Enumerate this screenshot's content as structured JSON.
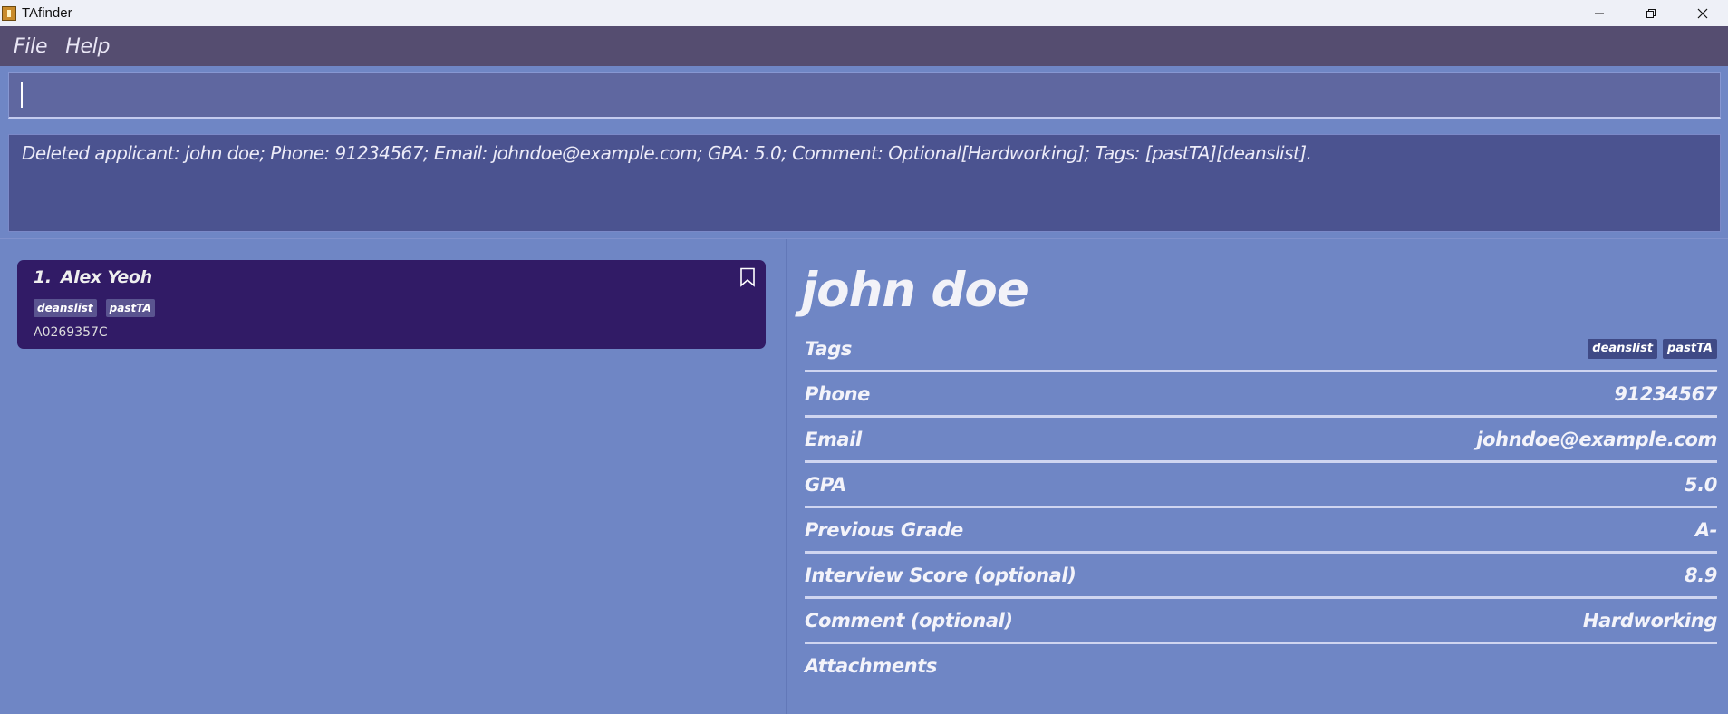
{
  "window": {
    "title": "TAfinder"
  },
  "menu": {
    "items": [
      {
        "label": "File"
      },
      {
        "label": "Help"
      }
    ]
  },
  "command": {
    "value": ""
  },
  "result": {
    "message": "Deleted applicant: john doe; Phone: 91234567; Email: johndoe@example.com; GPA: 5.0; Comment: Optional[Hardworking]; Tags: [pastTA][deanslist]."
  },
  "list": {
    "items": [
      {
        "index": "1.",
        "name": "Alex Yeoh",
        "tags": [
          "deanslist",
          "pastTA"
        ],
        "id": "A0269357C"
      }
    ]
  },
  "detail": {
    "name": "john doe",
    "tags_label": "Tags",
    "tags": [
      "deanslist",
      "pastTA"
    ],
    "rows": [
      {
        "label": "Phone",
        "value": "91234567"
      },
      {
        "label": "Email",
        "value": "johndoe@example.com"
      },
      {
        "label": "GPA",
        "value": "5.0"
      },
      {
        "label": "Previous Grade",
        "value": "A-"
      },
      {
        "label": "Interview Score (optional)",
        "value": "8.9"
      },
      {
        "label": "Comment (optional)",
        "value": "Hardworking"
      },
      {
        "label": "Attachments",
        "value": ""
      }
    ]
  },
  "colors": {
    "background": "#6f86c5",
    "menubar": "#554d70",
    "card": "#311b66",
    "result_box": "#4b5390",
    "command_box": "#5f67a0"
  }
}
